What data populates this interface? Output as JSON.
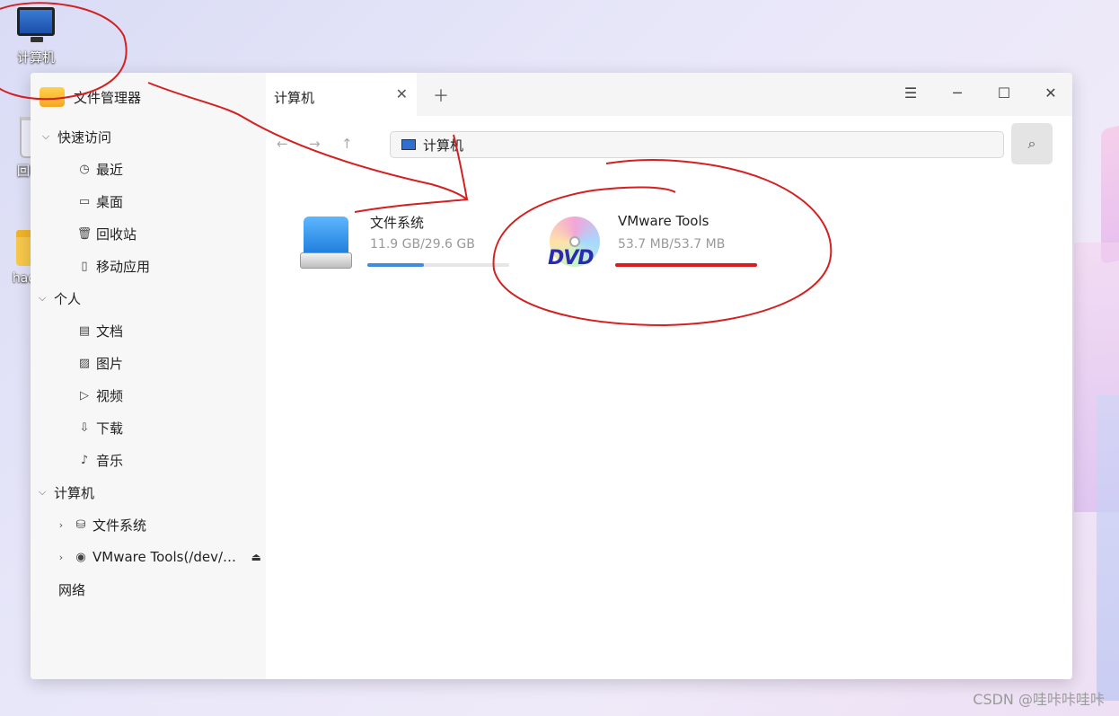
{
  "desktop": {
    "icons": [
      {
        "label": "计算机",
        "icon": "computer-icon"
      },
      {
        "label": "回收站",
        "icon": "trash-icon"
      },
      {
        "label": "hadoop",
        "icon": "folder-icon"
      }
    ]
  },
  "sidebar": {
    "app_title": "文件管理器",
    "quick_access": {
      "label": "快速访问",
      "items": [
        {
          "label": "最近",
          "icon": "clock-icon"
        },
        {
          "label": "桌面",
          "icon": "desktop-icon"
        },
        {
          "label": "回收站",
          "icon": "trash-icon"
        },
        {
          "label": "移动应用",
          "icon": "phone-icon"
        }
      ]
    },
    "personal": {
      "label": "个人",
      "items": [
        {
          "label": "文档",
          "icon": "document-icon"
        },
        {
          "label": "图片",
          "icon": "image-icon"
        },
        {
          "label": "视频",
          "icon": "video-icon"
        },
        {
          "label": "下载",
          "icon": "download-icon"
        },
        {
          "label": "音乐",
          "icon": "music-icon"
        }
      ]
    },
    "computer": {
      "label": "计算机",
      "items": [
        {
          "label": "文件系统",
          "icon": "drive-icon"
        },
        {
          "label": "VMware Tools(/dev/…",
          "icon": "dvd-icon"
        }
      ]
    },
    "network": {
      "label": "网络"
    }
  },
  "tabs": [
    {
      "label": "计算机"
    }
  ],
  "address": {
    "path": "计算机"
  },
  "devices": [
    {
      "name": "文件系统",
      "size": "11.9 GB/29.6 GB",
      "usage": 0.4,
      "icon": "hard-drive-icon"
    },
    {
      "name": "VMware Tools",
      "size": "53.7 MB/53.7 MB",
      "usage": 1.0,
      "icon": "dvd-icon",
      "bar_color": "#d91c1c"
    }
  ],
  "colors": {
    "accent": "#3d8ce0",
    "annotation": "#d42020"
  },
  "watermark": "CSDN @哇咔咔哇咔"
}
